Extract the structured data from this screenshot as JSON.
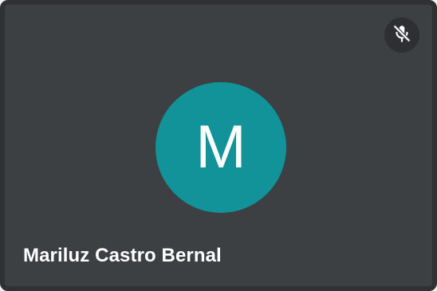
{
  "participant": {
    "name": "Mariluz Castro Bernal",
    "initial": "M",
    "avatar_color": "#12939a",
    "mic_state": "muted",
    "mic_icon": "mic-off-icon"
  },
  "colors": {
    "tile_background": "#3c4043",
    "tile_border": "#2f3133",
    "text": "#ffffff"
  }
}
